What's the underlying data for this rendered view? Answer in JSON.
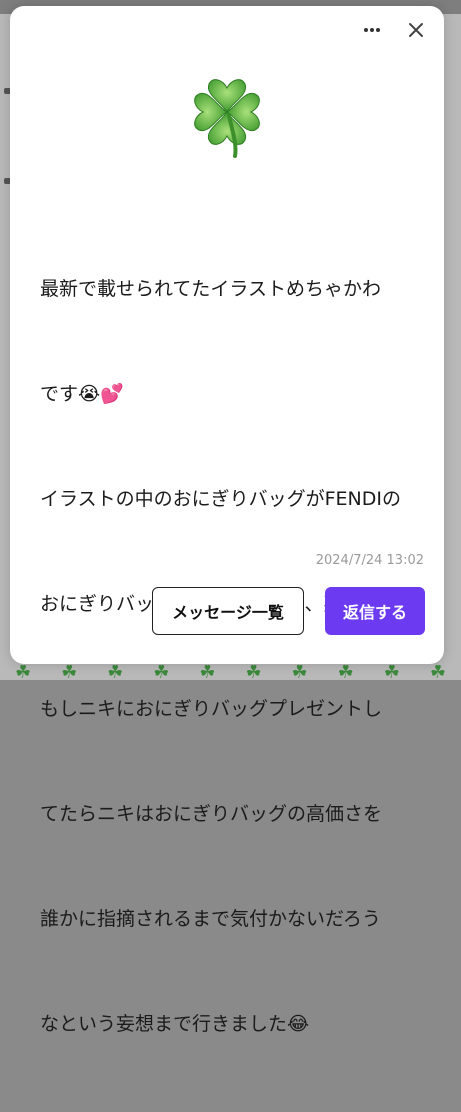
{
  "modal": {
    "message_lines": [
      "最新で載せられてたイラストめちゃかわ",
      "です😭💕",
      "イラストの中のおにぎりバッグがFENDIの",
      "おにぎりバッグと重なりまして、英智が",
      "もしニキにおにぎりバッグプレゼントし",
      "てたらニキはおにぎりバッグの高価さを",
      "誰かに指摘されるまで気付かないだろう",
      "なという妄想まで行きました😂"
    ],
    "timestamp": "2024/7/24 13:02",
    "message_list_button": "メッセージ一覧",
    "reply_button": "返信する"
  },
  "colors": {
    "accent": "#6c3bf1",
    "clover": "#4caf50"
  },
  "icons": {
    "header_image": "four-leaf-clover-icon",
    "menu": "more-icon",
    "close": "close-icon"
  }
}
